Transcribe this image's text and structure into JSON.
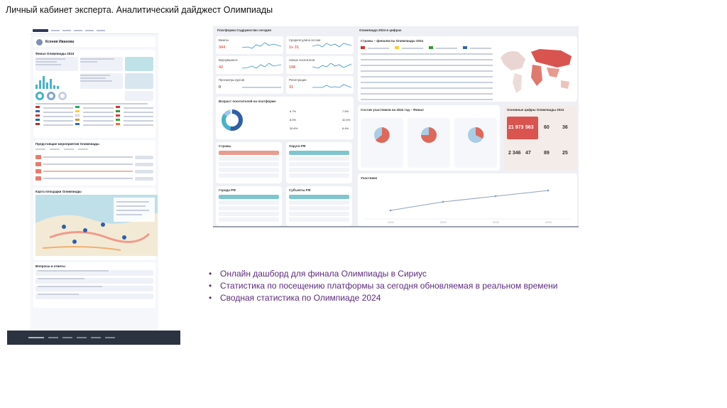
{
  "slide": {
    "title": "Личный кабинет эксперта. Аналитический дайджест Олимпиады"
  },
  "left_page": {
    "profile_name": "Ксения Иванова",
    "sections": [
      "Финал Олимпиады 2024",
      "Предстоящие мероприятия Олимпиады",
      "Карта площадки Олимпиады",
      "Вопросы и ответы"
    ]
  },
  "dashboard": {
    "header_left": "Платформа Содружество сегодня",
    "header_right": "Олимпиада 2024 в цифрах",
    "kpis": [
      {
        "title": "Визиты",
        "value": "344",
        "color": "#e0685a"
      },
      {
        "title": "Средняя длина сессии",
        "value": "1ч 31",
        "color": "#e0685a"
      },
      {
        "title": "Вернувшиеся",
        "value": "42",
        "color": "#e0685a"
      },
      {
        "title": "Новые посетители",
        "value": "198",
        "color": "#e0685a"
      },
      {
        "title": "Просмотры курсов",
        "value": "0",
        "color": "#555"
      },
      {
        "title": "Регистрации",
        "value": "31",
        "color": "#e0685a"
      }
    ],
    "age_title": "Возраст посетителей на платформе",
    "age_values": [
      "6.7%",
      "8.5%",
      "30.6%",
      "7.5%",
      "32.5%",
      "6.4%"
    ],
    "panels": [
      "Страны",
      "Округи РФ",
      "Города РФ",
      "Субъекты РФ"
    ],
    "countries_title": "Страны – финалисты Олимпиады 2024",
    "participants_title": "Состав участников на 2024 год – Финал",
    "main_numbers_title": "Основные цифры Олимпиады 2024",
    "main_numbers": [
      "21 973",
      "563",
      "60",
      "36",
      "2 346",
      "47",
      "89",
      "25"
    ],
    "participants_chart_title": "Участники",
    "years": [
      "2021",
      "2022",
      "2023",
      "2024"
    ]
  },
  "bullets": [
    "Онлайн дашборд для финала Олимпиады в Сириус",
    "Статистика по посещению платформы за сегодня обновляемая в реальном времени",
    "Сводная статистика по Олимпиаде 2024"
  ],
  "colors": {
    "bullet_text": "#5c2a7d",
    "accent_red": "#e0685a",
    "accent_teal": "#46b3c8"
  }
}
